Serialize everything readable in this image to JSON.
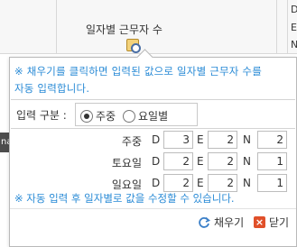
{
  "background": {
    "column_title": "일자별 근무자 수",
    "right_letters": [
      "D",
      "E",
      "N"
    ],
    "left_fragment": "na"
  },
  "popup": {
    "notice_line1": "※ 채우기를 클릭하면 입력된 값으로 일자별 근무자 수를",
    "notice_line2": "자동 입력합니다.",
    "mode_label": "입력 구분 :",
    "mode_options": [
      {
        "label": "주중",
        "selected": true
      },
      {
        "label": "요일별",
        "selected": false
      }
    ],
    "rows": [
      {
        "label": "주중",
        "d": "3",
        "e": "2",
        "n": "2"
      },
      {
        "label": "토요일",
        "d": "2",
        "e": "2",
        "n": "1"
      },
      {
        "label": "일요일",
        "d": "2",
        "e": "2",
        "n": "1"
      }
    ],
    "shift_letters": {
      "d": "D",
      "e": "E",
      "n": "N"
    },
    "auto_note": "※ 자동 입력 후 일자별로 값을 수정할 수 있습니다.",
    "buttons": {
      "fill": "채우기",
      "close": "닫기"
    }
  },
  "colors": {
    "accent": "#2a8bd6",
    "close": "#e0502a",
    "refresh": "#3a7fc8"
  }
}
